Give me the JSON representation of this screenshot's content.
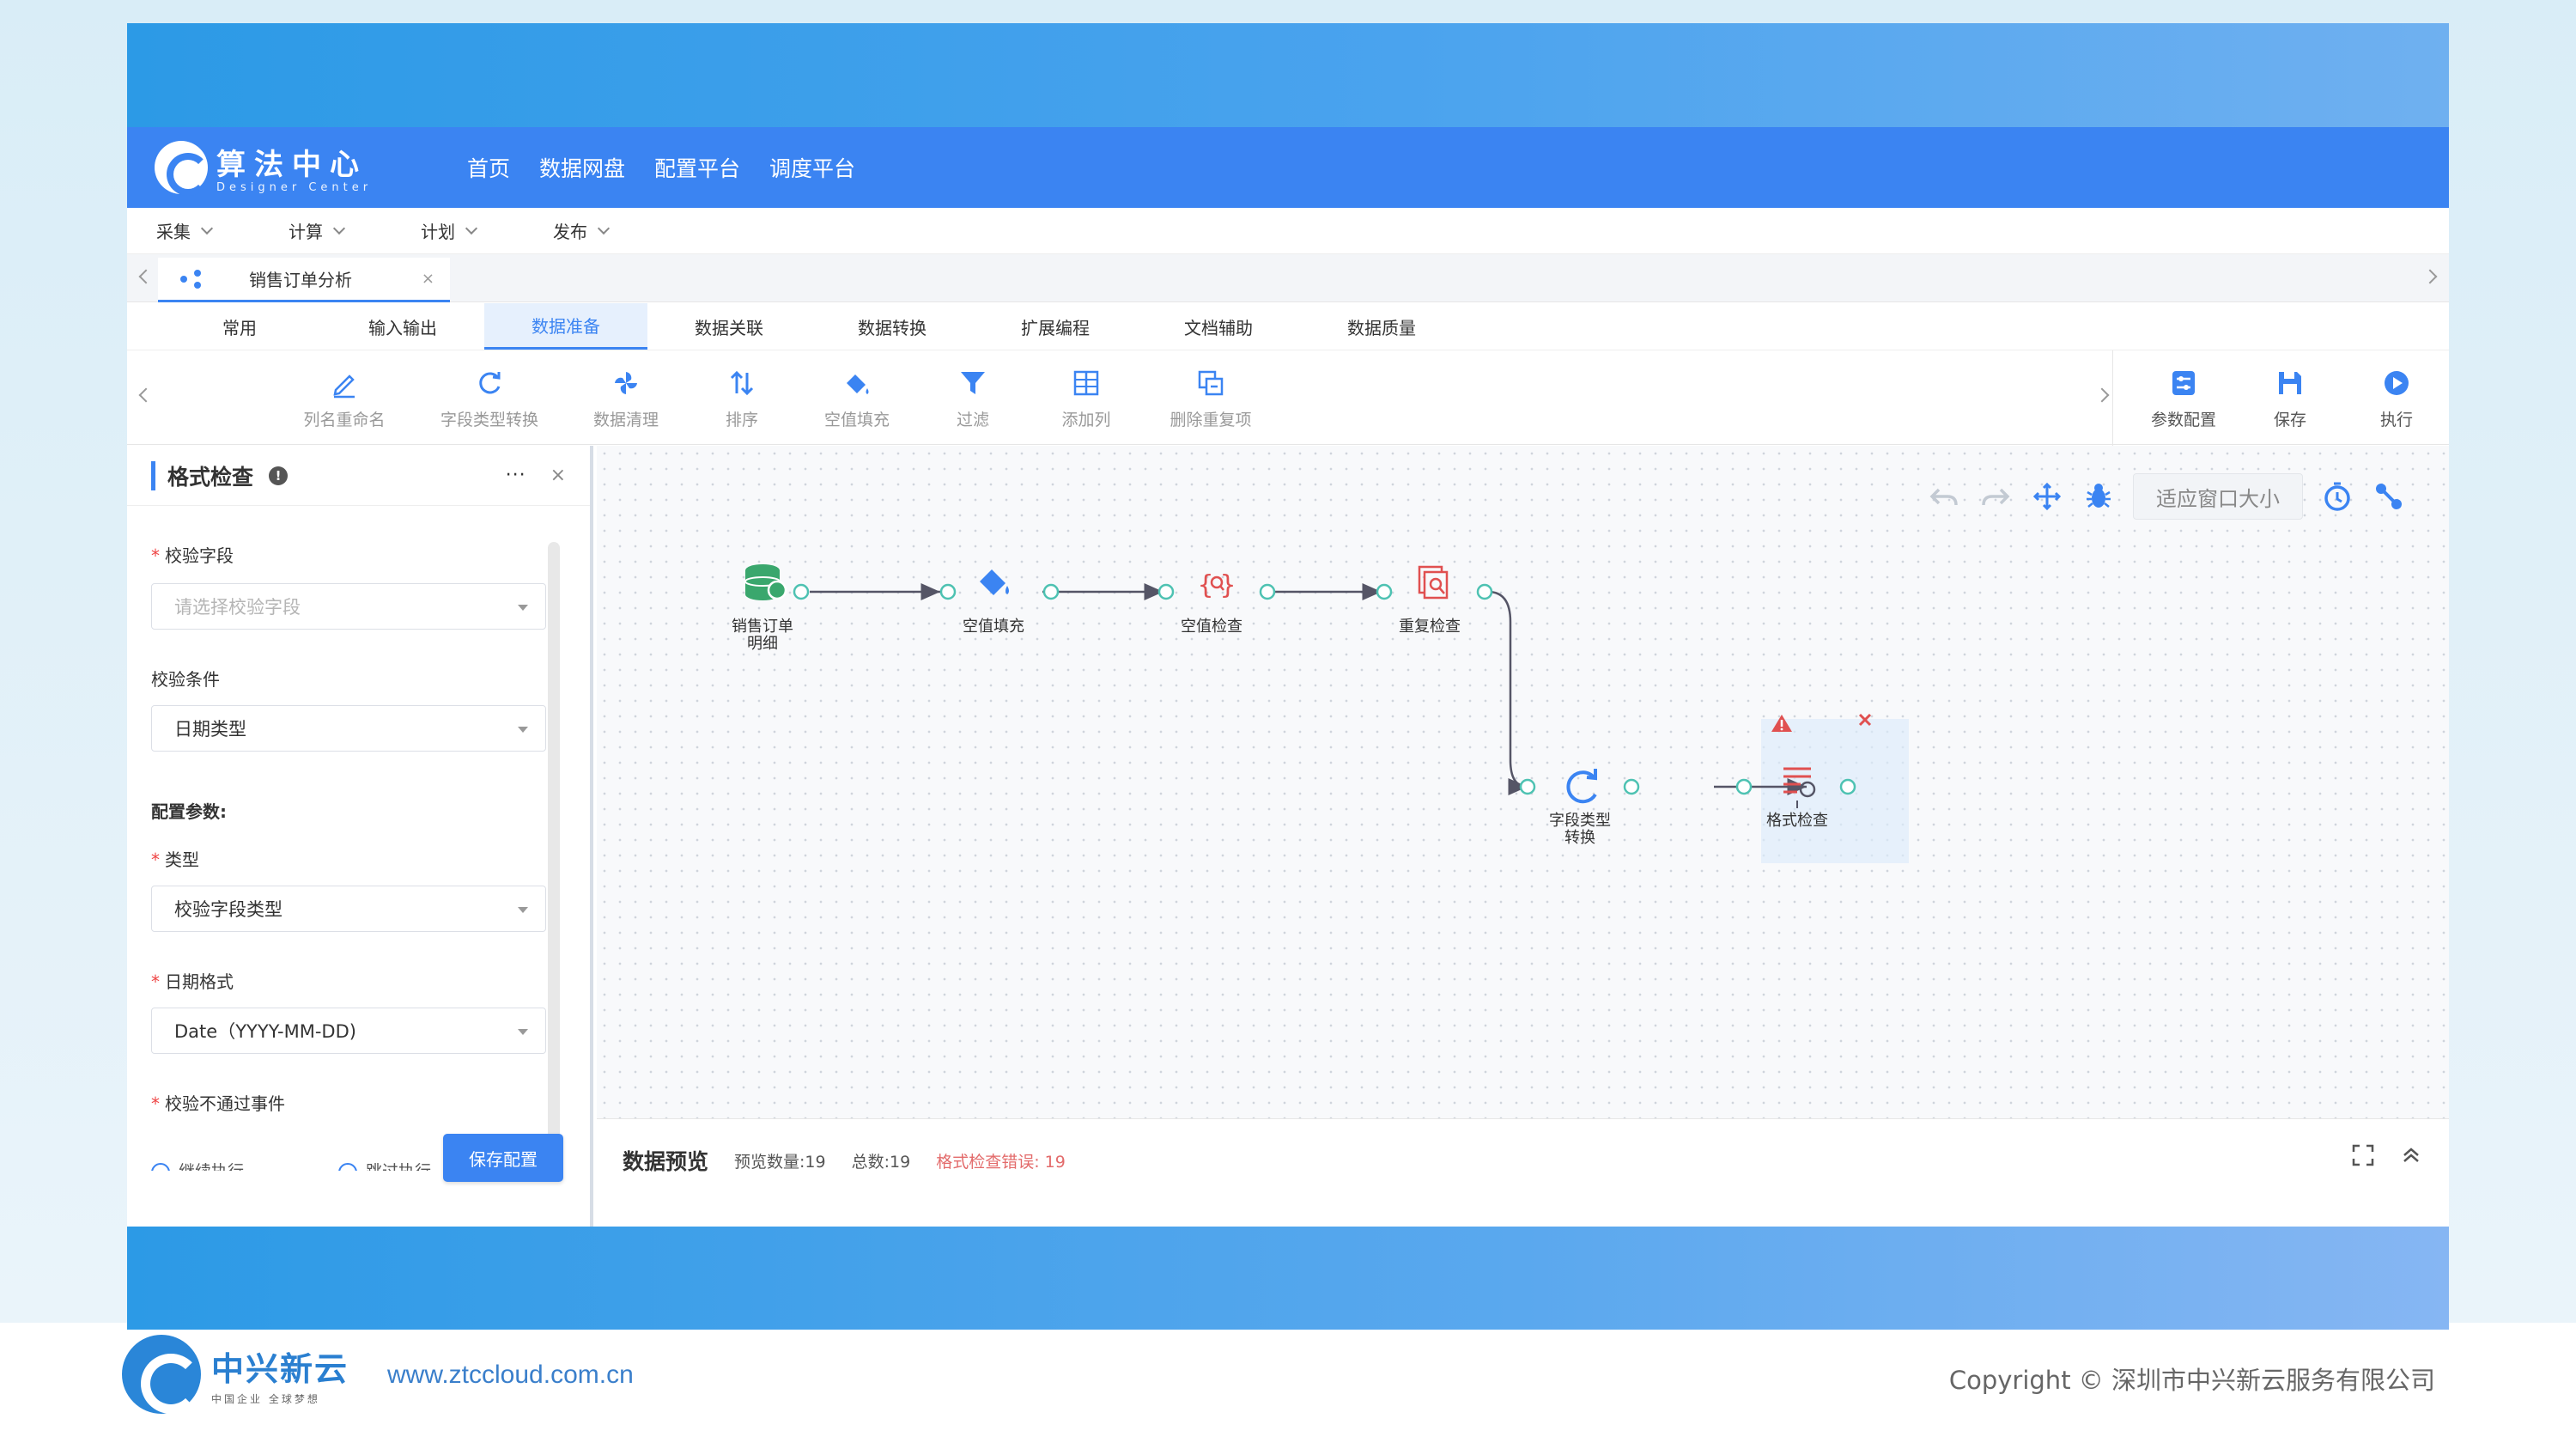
{
  "app": {
    "logo_title": "算法中心",
    "logo_sub": "Designer Center",
    "nav": [
      "首页",
      "数据网盘",
      "配置平台",
      "调度平台"
    ]
  },
  "menubar": [
    "采集",
    "计算",
    "计划",
    "发布"
  ],
  "doc_tab": {
    "label": "销售订单分析",
    "close": "×"
  },
  "category_tabs": [
    "常用",
    "输入输出",
    "数据准备",
    "数据关联",
    "数据转换",
    "扩展编程",
    "文档辅助",
    "数据质量"
  ],
  "active_category": "数据准备",
  "toolbar": {
    "tools": [
      {
        "label": "列名重命名",
        "icon": "edit-icon"
      },
      {
        "label": "字段类型转换",
        "icon": "refresh-icon"
      },
      {
        "label": "数据清理",
        "icon": "pinwheel-icon"
      },
      {
        "label": "排序",
        "icon": "sort-icon"
      },
      {
        "label": "空值填充",
        "icon": "fill-bucket-icon"
      },
      {
        "label": "过滤",
        "icon": "filter-icon"
      },
      {
        "label": "添加列",
        "icon": "add-column-icon"
      },
      {
        "label": "删除重复项",
        "icon": "dedupe-icon"
      }
    ],
    "right": [
      {
        "label": "参数配置",
        "icon": "settings-icon"
      },
      {
        "label": "保存",
        "icon": "save-icon"
      },
      {
        "label": "执行",
        "icon": "play-icon"
      }
    ]
  },
  "panel": {
    "title": "格式检查",
    "info": "!",
    "more": "···",
    "close": "×",
    "field_check_label": "校验字段",
    "field_check_placeholder": "请选择校验字段",
    "condition_label": "校验条件",
    "condition_value": "日期类型",
    "config_label": "配置参数:",
    "type_label": "类型",
    "type_value": "校验字段类型",
    "date_format_label": "日期格式",
    "date_format_value": "Date（YYYY-MM-DD)",
    "fail_event_label": "校验不通过事件",
    "fail_options": [
      "继续执行",
      "跳过执行"
    ],
    "save_button": "保存配置"
  },
  "canvas": {
    "fit_label": "适应窗口大小",
    "tool_icons": [
      "undo-icon",
      "redo-icon",
      "move-icon",
      "debug-icon",
      "timer-icon",
      "link-icon"
    ],
    "nodes": [
      {
        "label1": "销售订单",
        "label2": "明细",
        "icon": "database-icon",
        "color": "#3aa76d"
      },
      {
        "label1": "空值填充",
        "label2": "",
        "icon": "fill-bucket-icon",
        "color": "#3b84f2"
      },
      {
        "label1": "空值检查",
        "label2": "",
        "icon": "brace-search-icon",
        "color": "#e05050"
      },
      {
        "label1": "重复检查",
        "label2": "",
        "icon": "duplicate-search-icon",
        "color": "#e05050"
      },
      {
        "label1": "字段类型",
        "label2": "转换",
        "icon": "refresh-icon",
        "color": "#3b84f2"
      },
      {
        "label1": "格式检查",
        "label2": "",
        "icon": "format-check-icon",
        "color": "#e05050"
      }
    ]
  },
  "preview": {
    "title": "数据预览",
    "preview_count": "预览数量:19",
    "total": "总数:19",
    "error": "格式检查错误: 19"
  },
  "footer": {
    "brand": "中兴新云",
    "slogan": "中国企业 全球梦想",
    "url": "www.ztccloud.com.cn",
    "copyright": "Copyright © 深圳市中兴新云服务有限公司"
  },
  "colors": {
    "primary": "#3b84f2",
    "danger": "#e05050",
    "success": "#3aa76d"
  }
}
